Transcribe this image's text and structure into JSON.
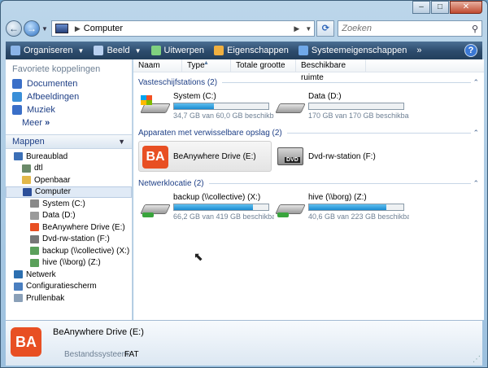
{
  "window": {
    "title": "Computer"
  },
  "caption": {
    "minimize": "–",
    "maximize": "□",
    "close": "✕"
  },
  "nav": {
    "back": "←",
    "forward": "→",
    "address_path": "Computer",
    "search_placeholder": "Zoeken"
  },
  "toolbar": {
    "items": [
      {
        "label": "Organiseren",
        "dropdown": true,
        "icon": "organize-icon"
      },
      {
        "label": "Beeld",
        "dropdown": true,
        "icon": "views-icon"
      },
      {
        "label": "Uitwerpen",
        "dropdown": false,
        "icon": "eject-icon"
      },
      {
        "label": "Eigenschappen",
        "dropdown": false,
        "icon": "properties-icon"
      },
      {
        "label": "Systeemeigenschappen",
        "dropdown": false,
        "icon": "system-properties-icon"
      }
    ],
    "more": "»",
    "help": "?"
  },
  "sidebar": {
    "favorites_title": "Favoriete koppelingen",
    "favorites": [
      {
        "label": "Documenten",
        "icon": "documents-icon",
        "color": "#3a6fc8"
      },
      {
        "label": "Afbeeldingen",
        "icon": "pictures-icon",
        "color": "#3a8fd8"
      },
      {
        "label": "Muziek",
        "icon": "music-icon",
        "color": "#3a6fc8"
      }
    ],
    "more": "Meer",
    "folders_title": "Mappen",
    "tree": [
      {
        "label": "Bureaublad",
        "indent": 0,
        "icon": "desktop-icon",
        "color": "#3b6fb6"
      },
      {
        "label": "dtl",
        "indent": 1,
        "icon": "user-folder-icon",
        "color": "#6a8a6a"
      },
      {
        "label": "Openbaar",
        "indent": 1,
        "icon": "public-folder-icon",
        "color": "#e2b84a"
      },
      {
        "label": "Computer",
        "indent": 1,
        "icon": "computer-icon",
        "color": "#2c4f9a",
        "selected": true
      },
      {
        "label": "System (C:)",
        "indent": 2,
        "icon": "system-drive-icon",
        "color": "#8a8a8a"
      },
      {
        "label": "Data (D:)",
        "indent": 2,
        "icon": "hard-drive-icon",
        "color": "#9a9a9a"
      },
      {
        "label": "BeAnywhere Drive (E:)",
        "indent": 2,
        "icon": "beanywhere-icon",
        "color": "#e84f23"
      },
      {
        "label": "Dvd-rw-station (F:)",
        "indent": 2,
        "icon": "dvd-drive-icon",
        "color": "#777777"
      },
      {
        "label": "backup (\\\\collective) (X:)",
        "indent": 2,
        "icon": "network-drive-icon",
        "color": "#5aa05a"
      },
      {
        "label": "hive (\\\\borg) (Z:)",
        "indent": 2,
        "icon": "network-drive-icon",
        "color": "#5aa05a"
      },
      {
        "label": "Netwerk",
        "indent": 0,
        "icon": "network-icon",
        "color": "#2c6fb0"
      },
      {
        "label": "Configuratiescherm",
        "indent": 0,
        "icon": "control-panel-icon",
        "color": "#4a7fc0"
      },
      {
        "label": "Prullenbak",
        "indent": 0,
        "icon": "recycle-bin-icon",
        "color": "#8aa0b8"
      }
    ]
  },
  "columns": [
    "Naam",
    "Type",
    "Totale grootte",
    "Beschikbare ruimte"
  ],
  "groups": {
    "hdd": {
      "title": "Vasteschijfstations (2)",
      "items": [
        {
          "name": "System (C:)",
          "sub": "34,7 GB van 60,0 GB beschikbaar",
          "used": 0.42
        },
        {
          "name": "Data (D:)",
          "sub": "170 GB van 170 GB beschikbaar",
          "used": 0.0
        }
      ]
    },
    "removable": {
      "title": "Apparaten met verwisselbare opslag (2)",
      "items": [
        {
          "name": "BeAnywhere Drive (E:)"
        },
        {
          "name": "Dvd-rw-station (F:)"
        }
      ]
    },
    "network": {
      "title": "Netwerklocatie (2)",
      "items": [
        {
          "name": "backup (\\\\collective) (X:)",
          "sub": "66,2 GB van 419 GB beschikbaar",
          "used": 0.84
        },
        {
          "name": "hive (\\\\borg) (Z:)",
          "sub": "40,6 GB van 223 GB beschikbaar",
          "used": 0.82
        }
      ]
    }
  },
  "details": {
    "title": "BeAnywhere Drive (E:)",
    "fs_label": "Bestandssysteem:",
    "fs_value": "FAT",
    "icon_text": "BA"
  },
  "logos": {
    "ba": "BA",
    "dvd": "DVD"
  }
}
